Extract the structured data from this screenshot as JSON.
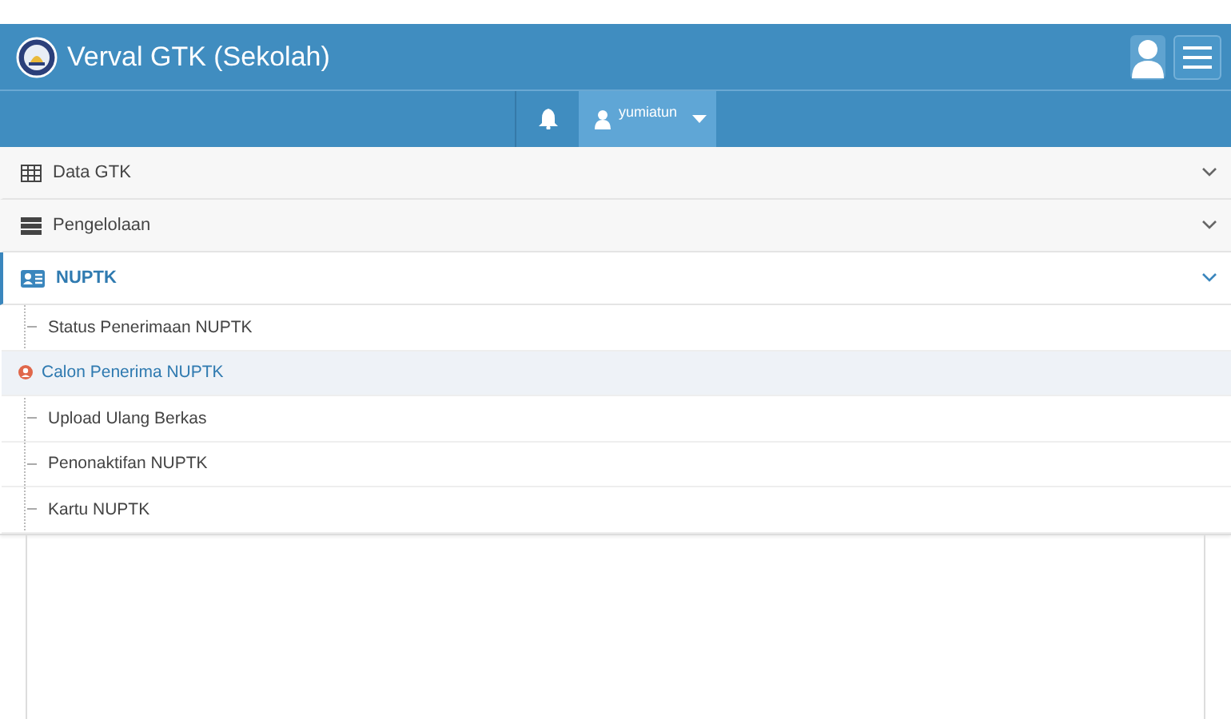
{
  "header": {
    "title": "Verval GTK (Sekolah)"
  },
  "navbar": {
    "user": "yumiatun"
  },
  "menu": [
    {
      "label": "Data GTK",
      "selected": false
    },
    {
      "label": "Pengelolaan",
      "selected": false
    },
    {
      "label": "NUPTK",
      "selected": true,
      "children": [
        {
          "label": "Status Penerimaan NUPTK",
          "selected": false
        },
        {
          "label": "Calon Penerima NUPTK",
          "selected": true
        },
        {
          "label": "Upload Ulang Berkas",
          "selected": false
        },
        {
          "label": "Penonaktifan NUPTK",
          "selected": false
        },
        {
          "label": "Kartu NUPTK",
          "selected": false
        }
      ]
    }
  ]
}
